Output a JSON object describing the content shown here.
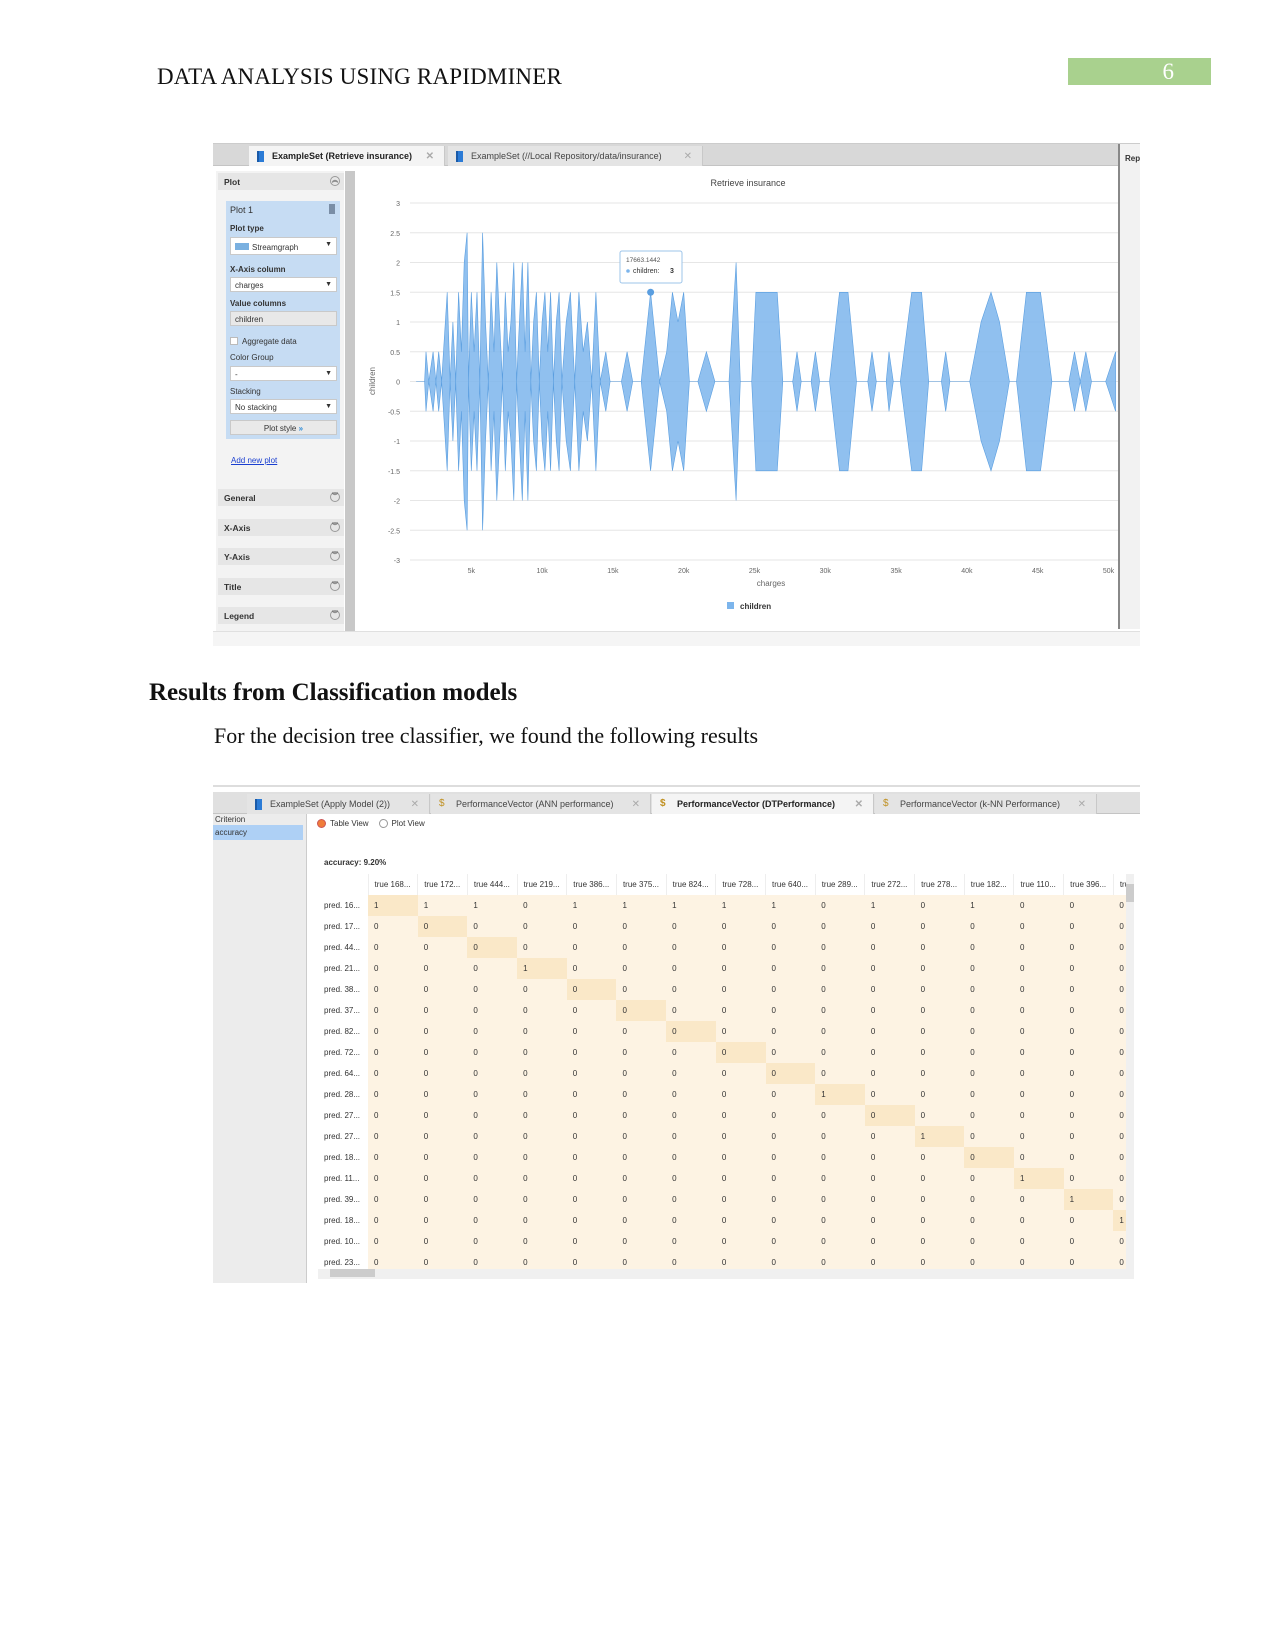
{
  "header": {
    "title": "DATA ANALYSIS USING RAPIDMINER",
    "page_number": "6",
    "accent": "#a9d18e"
  },
  "shot1": {
    "tabs": [
      {
        "label": "ExampleSet (Retrieve insurance)",
        "active": true
      },
      {
        "label": "ExampleSet (//Local Repository/data/insurance)",
        "active": false
      }
    ],
    "right_label": "Rep",
    "panel": {
      "section": "Plot",
      "plot_name": "Plot 1",
      "plot_type_label": "Plot type",
      "plot_type": "Streamgraph",
      "x_axis_label": "X-Axis column",
      "x_axis": "charges",
      "value_columns_label": "Value columns",
      "value_columns": "children",
      "aggregate_label": "Aggregate data",
      "color_group_label": "Color Group",
      "color_group": "-",
      "stacking_label": "Stacking",
      "stacking": "No stacking",
      "plot_style": "Plot style",
      "add_new_plot": "Add new plot",
      "sections": [
        "General",
        "X-Axis",
        "Y-Axis",
        "Title",
        "Legend"
      ]
    },
    "tooltip": {
      "x": "17663.1442",
      "series": "children:",
      "value": "3"
    }
  },
  "chart_data": {
    "type": "area",
    "subtype": "streamgraph",
    "title": "Retrieve insurance",
    "xlabel": "charges",
    "ylabel": "children",
    "yticks": [
      "3",
      "2.5",
      "2",
      "1.5",
      "1",
      "0.5",
      "0",
      "-0.5",
      "-1",
      "-1.5",
      "-2",
      "-2.5",
      "-3"
    ],
    "xticks": [
      "5k",
      "10k",
      "15k",
      "20k",
      "25k",
      "30k",
      "35k",
      "40k",
      "45k",
      "50k"
    ],
    "ylim": [
      -3,
      3
    ],
    "xlim": [
      0,
      50500
    ],
    "grid": true,
    "legend_position": "bottom",
    "color": "#7cb5ec",
    "series": [
      {
        "name": "children",
        "points": [
          [
            1100,
            0
          ],
          [
            1700,
            0
          ],
          [
            1800,
            1
          ],
          [
            2000,
            0
          ],
          [
            2300,
            1
          ],
          [
            2500,
            0
          ],
          [
            2700,
            1
          ],
          [
            2900,
            0
          ],
          [
            3300,
            3
          ],
          [
            3500,
            0
          ],
          [
            3700,
            2
          ],
          [
            3900,
            0
          ],
          [
            4100,
            3
          ],
          [
            4300,
            1
          ],
          [
            4500,
            4
          ],
          [
            4700,
            5
          ],
          [
            4800,
            0
          ],
          [
            5000,
            3
          ],
          [
            5200,
            1
          ],
          [
            5400,
            3
          ],
          [
            5600,
            0
          ],
          [
            5800,
            5
          ],
          [
            6000,
            2
          ],
          [
            6200,
            0
          ],
          [
            6400,
            3
          ],
          [
            6600,
            1
          ],
          [
            6800,
            4
          ],
          [
            7000,
            2
          ],
          [
            7200,
            0
          ],
          [
            7400,
            3
          ],
          [
            7600,
            1
          ],
          [
            7800,
            2
          ],
          [
            8000,
            4
          ],
          [
            8200,
            0
          ],
          [
            8400,
            2
          ],
          [
            8600,
            4
          ],
          [
            8800,
            1
          ],
          [
            9000,
            4
          ],
          [
            9200,
            0
          ],
          [
            9400,
            2
          ],
          [
            9600,
            3
          ],
          [
            9800,
            0
          ],
          [
            10000,
            2
          ],
          [
            10200,
            3
          ],
          [
            10400,
            1
          ],
          [
            10600,
            3
          ],
          [
            10800,
            0
          ],
          [
            11000,
            2
          ],
          [
            11200,
            3
          ],
          [
            11400,
            0
          ],
          [
            11700,
            2
          ],
          [
            12000,
            3
          ],
          [
            12300,
            0
          ],
          [
            12600,
            3
          ],
          [
            12900,
            1
          ],
          [
            13200,
            2
          ],
          [
            13500,
            0
          ],
          [
            13800,
            3
          ],
          [
            14100,
            0
          ],
          [
            14500,
            1
          ],
          [
            14800,
            0
          ],
          [
            15600,
            0
          ],
          [
            16000,
            1
          ],
          [
            16400,
            0
          ],
          [
            17000,
            0
          ],
          [
            17663,
            3
          ],
          [
            18300,
            0
          ],
          [
            18800,
            1
          ],
          [
            19200,
            3
          ],
          [
            19600,
            2
          ],
          [
            20000,
            3
          ],
          [
            20400,
            0
          ],
          [
            21000,
            0
          ],
          [
            21600,
            1
          ],
          [
            22200,
            0
          ],
          [
            23200,
            0
          ],
          [
            23700,
            4
          ],
          [
            24000,
            0
          ],
          [
            24800,
            0
          ],
          [
            25100,
            3
          ],
          [
            26600,
            3
          ],
          [
            27000,
            0
          ],
          [
            27700,
            0
          ],
          [
            28000,
            1
          ],
          [
            28300,
            0
          ],
          [
            29000,
            0
          ],
          [
            29300,
            1
          ],
          [
            29600,
            0
          ],
          [
            30300,
            0
          ],
          [
            31000,
            3
          ],
          [
            31600,
            3
          ],
          [
            32200,
            0
          ],
          [
            33000,
            0
          ],
          [
            33300,
            1
          ],
          [
            33600,
            0
          ],
          [
            34300,
            0
          ],
          [
            34500,
            1
          ],
          [
            34800,
            0
          ],
          [
            35300,
            0
          ],
          [
            36100,
            3
          ],
          [
            36800,
            3
          ],
          [
            37300,
            0
          ],
          [
            38200,
            0
          ],
          [
            38500,
            1
          ],
          [
            38800,
            0
          ],
          [
            40200,
            0
          ],
          [
            41000,
            2
          ],
          [
            41700,
            3
          ],
          [
            42300,
            2
          ],
          [
            43000,
            0
          ],
          [
            43500,
            0
          ],
          [
            44200,
            3
          ],
          [
            45200,
            3
          ],
          [
            46000,
            0
          ],
          [
            47200,
            0
          ],
          [
            47600,
            1
          ],
          [
            48000,
            0
          ],
          [
            48400,
            1
          ],
          [
            48800,
            0
          ],
          [
            49800,
            0
          ],
          [
            50500,
            1
          ]
        ]
      }
    ]
  },
  "section": {
    "heading": "Results from Classification models",
    "paragraph": "For the decision tree classifier, we found the following results"
  },
  "shot2": {
    "tabs": [
      {
        "label": "ExampleSet (Apply Model (2))",
        "active": false
      },
      {
        "label": "PerformanceVector (ANN performance)",
        "active": false
      },
      {
        "label": "PerformanceVector (DTPerformance)",
        "active": true
      },
      {
        "label": "PerformanceVector (k-NN Performance)",
        "active": false
      }
    ],
    "criterion_label": "Criterion",
    "criterion": "accuracy",
    "table_view": "Table View",
    "plot_view": "Plot View",
    "accuracy": "accuracy: 9.20%",
    "columns": [
      "true 168...",
      "true 172...",
      "true 444...",
      "true 219...",
      "true 386...",
      "true 375...",
      "true 824...",
      "true 728...",
      "true 640...",
      "true 289...",
      "true 272...",
      "true 278...",
      "true 182...",
      "true 110...",
      "true 396...",
      "true..."
    ],
    "rows": [
      {
        "label": "pred. 16...",
        "values": [
          "1",
          "1",
          "1",
          "0",
          "1",
          "1",
          "1",
          "1",
          "1",
          "0",
          "1",
          "0",
          "1",
          "0",
          "0",
          "0"
        ]
      },
      {
        "label": "pred. 17...",
        "values": [
          "0",
          "0",
          "0",
          "0",
          "0",
          "0",
          "0",
          "0",
          "0",
          "0",
          "0",
          "0",
          "0",
          "0",
          "0",
          "0"
        ]
      },
      {
        "label": "pred. 44...",
        "values": [
          "0",
          "0",
          "0",
          "0",
          "0",
          "0",
          "0",
          "0",
          "0",
          "0",
          "0",
          "0",
          "0",
          "0",
          "0",
          "0"
        ]
      },
      {
        "label": "pred. 21...",
        "values": [
          "0",
          "0",
          "0",
          "1",
          "0",
          "0",
          "0",
          "0",
          "0",
          "0",
          "0",
          "0",
          "0",
          "0",
          "0",
          "0"
        ]
      },
      {
        "label": "pred. 38...",
        "values": [
          "0",
          "0",
          "0",
          "0",
          "0",
          "0",
          "0",
          "0",
          "0",
          "0",
          "0",
          "0",
          "0",
          "0",
          "0",
          "0"
        ]
      },
      {
        "label": "pred. 37...",
        "values": [
          "0",
          "0",
          "0",
          "0",
          "0",
          "0",
          "0",
          "0",
          "0",
          "0",
          "0",
          "0",
          "0",
          "0",
          "0",
          "0"
        ]
      },
      {
        "label": "pred. 82...",
        "values": [
          "0",
          "0",
          "0",
          "0",
          "0",
          "0",
          "0",
          "0",
          "0",
          "0",
          "0",
          "0",
          "0",
          "0",
          "0",
          "0"
        ]
      },
      {
        "label": "pred. 72...",
        "values": [
          "0",
          "0",
          "0",
          "0",
          "0",
          "0",
          "0",
          "0",
          "0",
          "0",
          "0",
          "0",
          "0",
          "0",
          "0",
          "0"
        ]
      },
      {
        "label": "pred. 64...",
        "values": [
          "0",
          "0",
          "0",
          "0",
          "0",
          "0",
          "0",
          "0",
          "0",
          "0",
          "0",
          "0",
          "0",
          "0",
          "0",
          "0"
        ]
      },
      {
        "label": "pred. 28...",
        "values": [
          "0",
          "0",
          "0",
          "0",
          "0",
          "0",
          "0",
          "0",
          "0",
          "1",
          "0",
          "0",
          "0",
          "0",
          "0",
          "0"
        ]
      },
      {
        "label": "pred. 27...",
        "values": [
          "0",
          "0",
          "0",
          "0",
          "0",
          "0",
          "0",
          "0",
          "0",
          "0",
          "0",
          "0",
          "0",
          "0",
          "0",
          "0"
        ]
      },
      {
        "label": "pred. 27...",
        "values": [
          "0",
          "0",
          "0",
          "0",
          "0",
          "0",
          "0",
          "0",
          "0",
          "0",
          "0",
          "1",
          "0",
          "0",
          "0",
          "0"
        ]
      },
      {
        "label": "pred. 18...",
        "values": [
          "0",
          "0",
          "0",
          "0",
          "0",
          "0",
          "0",
          "0",
          "0",
          "0",
          "0",
          "0",
          "0",
          "0",
          "0",
          "0"
        ]
      },
      {
        "label": "pred. 11...",
        "values": [
          "0",
          "0",
          "0",
          "0",
          "0",
          "0",
          "0",
          "0",
          "0",
          "0",
          "0",
          "0",
          "0",
          "1",
          "0",
          "0"
        ]
      },
      {
        "label": "pred. 39...",
        "values": [
          "0",
          "0",
          "0",
          "0",
          "0",
          "0",
          "0",
          "0",
          "0",
          "0",
          "0",
          "0",
          "0",
          "0",
          "1",
          "0"
        ]
      },
      {
        "label": "pred. 18...",
        "values": [
          "0",
          "0",
          "0",
          "0",
          "0",
          "0",
          "0",
          "0",
          "0",
          "0",
          "0",
          "0",
          "0",
          "0",
          "0",
          "1"
        ]
      },
      {
        "label": "pred. 10...",
        "values": [
          "0",
          "0",
          "0",
          "0",
          "0",
          "0",
          "0",
          "0",
          "0",
          "0",
          "0",
          "0",
          "0",
          "0",
          "0",
          "0"
        ]
      },
      {
        "label": "pred. 23...",
        "values": [
          "0",
          "0",
          "0",
          "0",
          "0",
          "0",
          "0",
          "0",
          "0",
          "0",
          "0",
          "0",
          "0",
          "0",
          "0",
          "0"
        ]
      }
    ]
  }
}
